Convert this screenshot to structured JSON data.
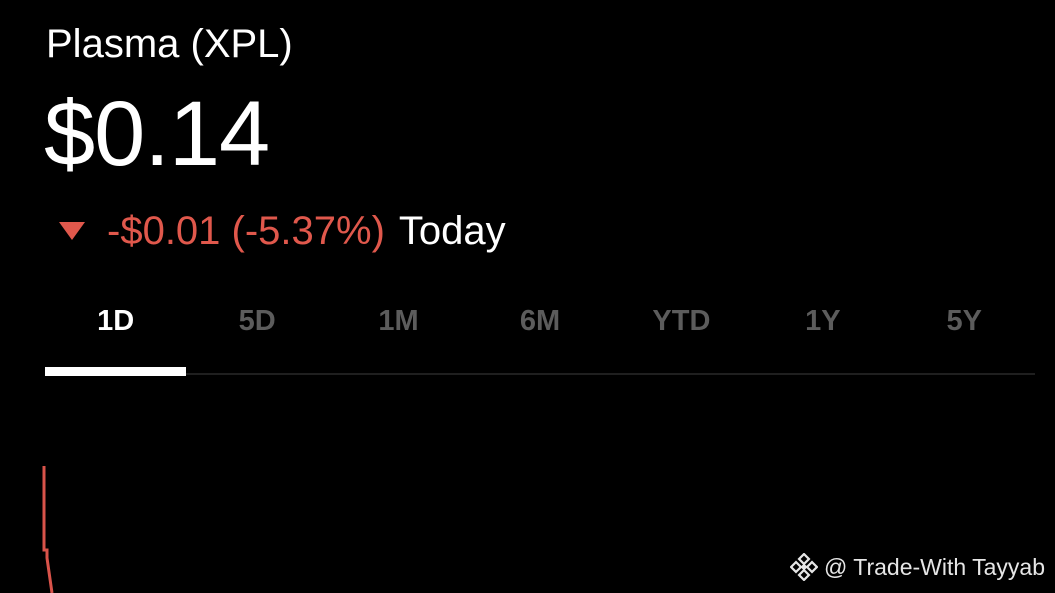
{
  "asset": {
    "name": "Plasma (XPL)",
    "price": "$0.14"
  },
  "change": {
    "direction_icon": "triangle-down-icon",
    "text": "-$0.01 (-5.37%)",
    "period": "Today",
    "color": "#e0584c"
  },
  "tabs": {
    "selected": "1D",
    "items": [
      {
        "label": "1D",
        "selected": true
      },
      {
        "label": "5D",
        "selected": false
      },
      {
        "label": "1M",
        "selected": false
      },
      {
        "label": "6M",
        "selected": false
      },
      {
        "label": "YTD",
        "selected": false
      },
      {
        "label": "1Y",
        "selected": false
      },
      {
        "label": "5Y",
        "selected": false
      }
    ],
    "selected_color": "#ffffff",
    "unselected_color": "#5c5c5c"
  },
  "chart": {
    "line_color": "#d9534a",
    "background": "#000000"
  },
  "watermark": {
    "icon": "binance-diamond-icon",
    "text": "@ Trade-With Tayyab"
  }
}
